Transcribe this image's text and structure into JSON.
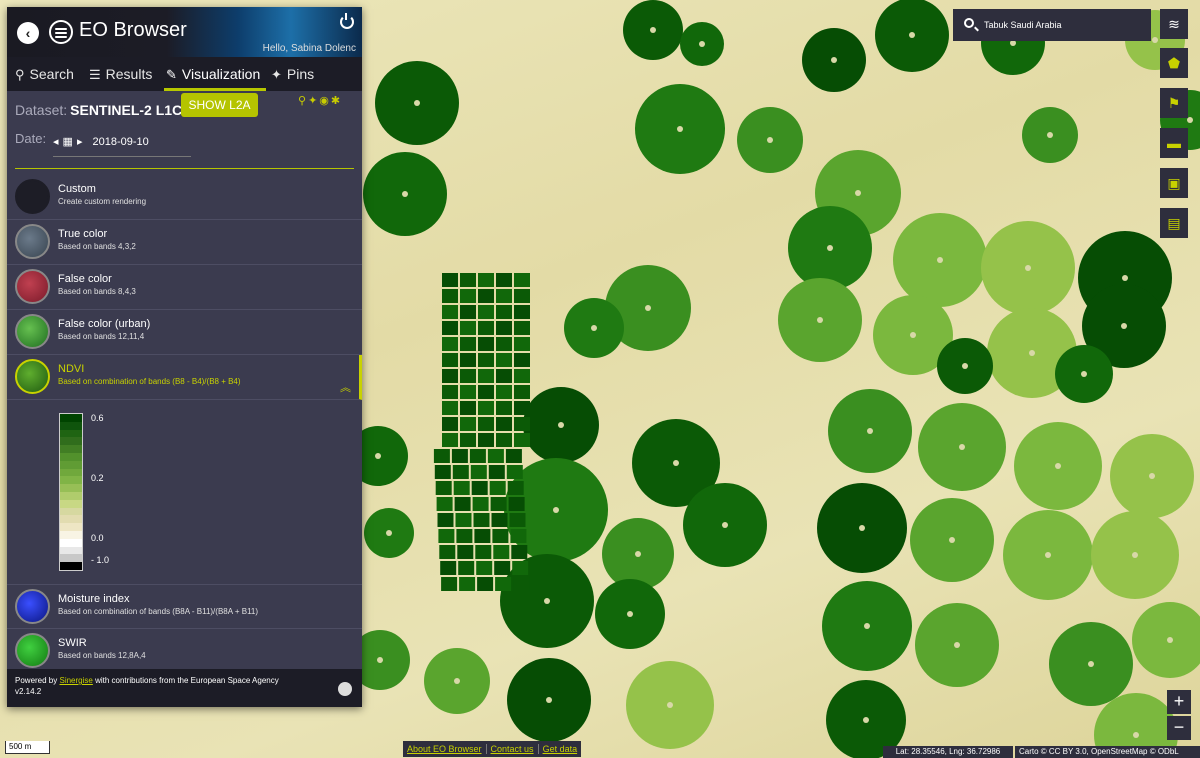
{
  "header": {
    "app_title": "EO Browser",
    "greeting": "Hello, Sabina Dolenc"
  },
  "tabs": [
    {
      "label": "Search",
      "icon": "search-icon"
    },
    {
      "label": "Results",
      "icon": "sliders-icon"
    },
    {
      "label": "Visualization",
      "icon": "brush-icon"
    },
    {
      "label": "Pins",
      "icon": "pin-icon"
    }
  ],
  "dataset": {
    "label": "Dataset:",
    "value": "SENTINEL-2 L1C",
    "show_l2a_label": "SHOW L2A"
  },
  "date": {
    "label": "Date:",
    "value": "2018-09-10"
  },
  "layers": [
    {
      "name": "Custom",
      "description": "Create custom rendering"
    },
    {
      "name": "True color",
      "description": "Based on bands 4,3,2"
    },
    {
      "name": "False color",
      "description": "Based on bands 8,4,3"
    },
    {
      "name": "False color (urban)",
      "description": "Based on bands 12,11,4"
    },
    {
      "name": "NDVI",
      "description": "Based on combination of bands (B8 - B4)/(B8 + B4)",
      "active": true
    },
    {
      "name": "Moisture index",
      "description": "Based on combination of bands (B8A - B11)/(B8A + B11)"
    },
    {
      "name": "SWIR",
      "description": "Based on bands 12,8A,4"
    }
  ],
  "legend": {
    "ticks": [
      "0.6",
      "0.2",
      "0.0",
      "- 1.0"
    ],
    "colors": [
      "#004400",
      "#0f540c",
      "#1f6412",
      "#306d1c",
      "#417e24",
      "#52912c",
      "#609c34",
      "#70a83c",
      "#80b446",
      "#97bf56",
      "#b0cc6c",
      "#c8d884",
      "#d6d8a0",
      "#e2dcb0",
      "#eee6c4",
      "#f8f4e4",
      "#ffffff",
      "#e8e8e8",
      "#c8c8c8",
      "#000000"
    ]
  },
  "footer": {
    "powered_prefix": "Powered by",
    "powered_link": "Sinergise",
    "powered_suffix": "with contributions from the European Space Agency",
    "version": "v2.14.2"
  },
  "search": {
    "value": "Tabuk Saudi Arabia"
  },
  "map": {
    "scale": "500 m",
    "links": [
      "About EO Browser",
      "Contact us",
      "Get data"
    ],
    "coords": "Lat: 28.35546, Lng: 36.72986",
    "attribution": "Carto © CC BY 3.0, OpenStreetMap © ODbL"
  }
}
